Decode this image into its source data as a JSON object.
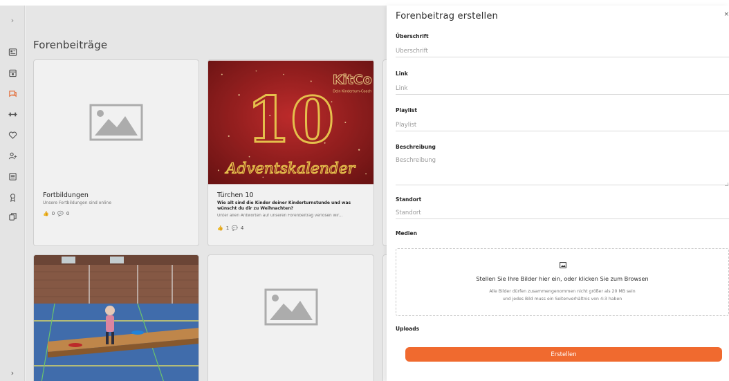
{
  "main": {
    "title": "Forenbeiträge",
    "cards": [
      {
        "title": "Fortbildungen",
        "subtitle": "Unsere Fortbildungen sind online",
        "likes": "0",
        "comments": "0"
      },
      {
        "title": "Türchen 10",
        "question": "Wie alt sind die Kinder deiner Kinderturnstunde und was wünscht du dir zu Weihnachten?",
        "excerpt": "Unter allen Antworten auf unseren Forenbeitrag verlosen wir...",
        "likes": "1",
        "comments": "4",
        "badge_number": "10",
        "logo_text": "KitCo",
        "logo_sub": "Dein Kinderturn-Coach",
        "banner_text": "Adventskalender"
      }
    ]
  },
  "drawer": {
    "title": "Forenbeitrag erstellen",
    "close_label": "×",
    "fields": {
      "heading_label": "Überschrift",
      "heading_placeholder": "Überschrift",
      "link_label": "Link",
      "link_placeholder": "Link",
      "playlist_label": "Playlist",
      "playlist_placeholder": "Playlist",
      "description_label": "Beschreibung",
      "description_placeholder": "Beschreibung",
      "location_label": "Standort",
      "location_placeholder": "Standort"
    },
    "media_label": "Medien",
    "dropzone": {
      "heading": "Stellen Sie Ihre Bilder hier ein, oder klicken Sie zum Browsen",
      "note_line1": "Alle Bilder dürfen zusammengenommen nicht größer als 20 MB sein",
      "note_line2": "und jedes Bild muss ein Seitenverhältnis von 4:3 haben"
    },
    "uploads_label": "Uploads",
    "submit_label": "Erstellen"
  },
  "colors": {
    "accent": "#f06a2f",
    "christmas_red": "#a51c1c",
    "gold": "#f2c94c"
  },
  "icons": [
    "chevron-right-icon",
    "dashboard-icon",
    "calendar-icon",
    "forum-icon",
    "dumbbell-icon",
    "heart-icon",
    "add-user-icon",
    "list-icon",
    "award-icon",
    "copy-icon",
    "image-placeholder-icon",
    "like-icon",
    "comment-icon",
    "image-icon"
  ]
}
